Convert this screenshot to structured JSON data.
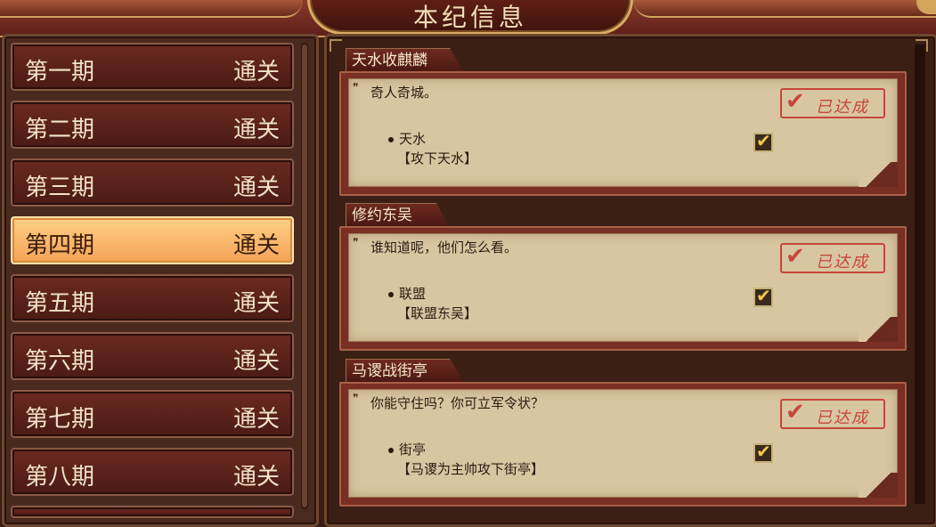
{
  "header": {
    "title": "本纪信息"
  },
  "periods": [
    {
      "name": "第一期",
      "status": "通关"
    },
    {
      "name": "第二期",
      "status": "通关"
    },
    {
      "name": "第三期",
      "status": "通关"
    },
    {
      "name": "第四期",
      "status": "通关"
    },
    {
      "name": "第五期",
      "status": "通关"
    },
    {
      "name": "第六期",
      "status": "通关"
    },
    {
      "name": "第七期",
      "status": "通关"
    },
    {
      "name": "第八期",
      "status": "通关"
    }
  ],
  "selected_period_index": 3,
  "missions": [
    {
      "title": "天水收麒麟",
      "quote": "奇人奇城。",
      "stamp": "已达成",
      "objective": "天水",
      "requirement": "【攻下天水】",
      "completed": true
    },
    {
      "title": "修约东吴",
      "quote": "谁知道呢，他们怎么看。",
      "stamp": "已达成",
      "objective": "联盟",
      "requirement": "【联盟东吴】",
      "completed": true
    },
    {
      "title": "马谡战街亭",
      "quote": "你能守住吗？你可立军令状？",
      "stamp": "已达成",
      "objective": "街亭",
      "requirement": "【马谡为主帅攻下街亭】",
      "completed": true
    }
  ],
  "colors": {
    "active_period": "#f7b569",
    "stamp_red": "#c7463c",
    "paper": "#d8c6a2"
  }
}
